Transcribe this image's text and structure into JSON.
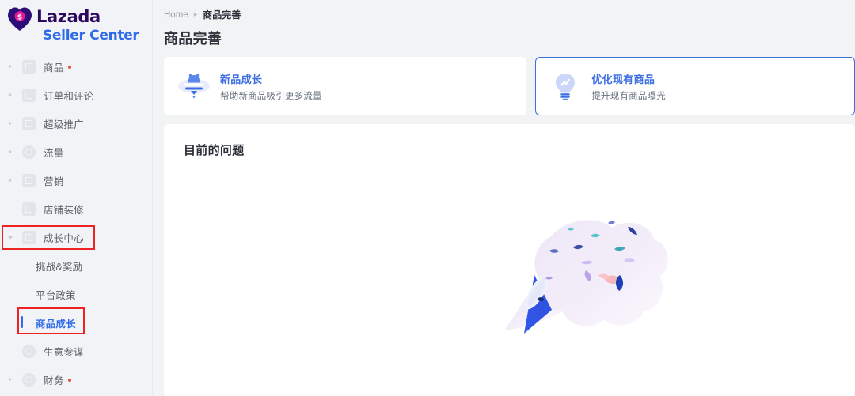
{
  "brand": {
    "name": "Lazada",
    "sub": "Seller Center",
    "logo_icon": "lazada-heart-logo",
    "colors": {
      "word": "#2b0a5e",
      "sub": "#2e6bea",
      "heart": "#2d0d77",
      "coin": "#e5199a"
    }
  },
  "sidebar": {
    "items": [
      {
        "label": "商品",
        "icon": "product-icon",
        "expandable": true,
        "badge": true,
        "shape": "sq"
      },
      {
        "label": "订单和评论",
        "icon": "orders-reviews-icon",
        "expandable": true,
        "badge": false,
        "shape": "sq"
      },
      {
        "label": "超级推广",
        "icon": "super-promotion-icon",
        "expandable": true,
        "badge": false,
        "shape": "hex"
      },
      {
        "label": "流量",
        "icon": "traffic-icon",
        "expandable": true,
        "badge": false,
        "shape": "circ"
      },
      {
        "label": "营销",
        "icon": "marketing-gear-icon",
        "expandable": true,
        "badge": false,
        "shape": "hex"
      },
      {
        "label": "店铺装修",
        "icon": "shop-decoration-icon",
        "expandable": false,
        "badge": false,
        "shape": "sq"
      },
      {
        "label": "成长中心",
        "icon": "growth-center-icon",
        "expandable": true,
        "expanded": true,
        "badge": false,
        "shape": "sq",
        "annotated": true
      },
      {
        "label": "生意参谋",
        "icon": "business-advisor-icon",
        "expandable": false,
        "badge": false,
        "shape": "circ"
      },
      {
        "label": "财务",
        "icon": "finance-icon",
        "expandable": true,
        "badge": true,
        "shape": "circ"
      }
    ],
    "subitems": [
      {
        "label": "挑战&奖励",
        "active": false
      },
      {
        "label": "平台政策",
        "active": false
      },
      {
        "label": "商品成长",
        "active": true,
        "annotated": true
      }
    ]
  },
  "breadcrumb": {
    "home": "Home",
    "separator": "▸",
    "current": "商品完善"
  },
  "page": {
    "title": "商品完善"
  },
  "cards": [
    {
      "title": "新品成长",
      "subtitle": "帮助新商品吸引更多流量",
      "icon": "new-product-growth-icon",
      "selected": false
    },
    {
      "title": "优化现有商品",
      "subtitle": "提升现有商品曝光",
      "icon": "lightbulb-icon",
      "selected": true
    }
  ],
  "panel": {
    "title": "目前的问题",
    "illustration": "confetti-party-popper-illustration"
  },
  "accent": {
    "blue": "#3d6fe3",
    "border_blue": "#3b6fe0",
    "annotation_red": "#ee2222",
    "badge_red": "#e8503a"
  }
}
